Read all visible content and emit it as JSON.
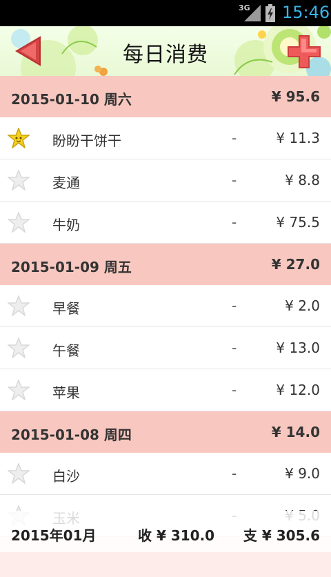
{
  "status_bar": {
    "network": "3G",
    "time": "15:46"
  },
  "header": {
    "title": "每日消费"
  },
  "days": [
    {
      "date": "2015-01-10  周六",
      "total": "¥ 95.6",
      "items": [
        {
          "name": "盼盼干饼干",
          "dash": "-",
          "amount": "¥ 11.3",
          "starred": true
        },
        {
          "name": "麦通",
          "dash": "-",
          "amount": "¥ 8.8",
          "starred": false
        },
        {
          "name": "牛奶",
          "dash": "-",
          "amount": "¥ 75.5",
          "starred": false
        }
      ]
    },
    {
      "date": "2015-01-09  周五",
      "total": "¥ 27.0",
      "items": [
        {
          "name": "早餐",
          "dash": "-",
          "amount": "¥ 2.0",
          "starred": false
        },
        {
          "name": "午餐",
          "dash": "-",
          "amount": "¥ 13.0",
          "starred": false
        },
        {
          "name": "苹果",
          "dash": "-",
          "amount": "¥ 12.0",
          "starred": false
        }
      ]
    },
    {
      "date": "2015-01-08  周四",
      "total": "¥ 14.0",
      "items": [
        {
          "name": "白沙",
          "dash": "-",
          "amount": "¥ 9.0",
          "starred": false
        },
        {
          "name": "玉米",
          "dash": "-",
          "amount": "¥ 5.0",
          "starred": false
        }
      ]
    }
  ],
  "footer": {
    "month": "2015年01月",
    "income": "收 ¥ 310.0",
    "expense": "支 ¥ 305.6"
  },
  "colors": {
    "day_header_bg": "#f8c8c0",
    "time_color": "#38b4e8",
    "star_active": "#f5d020"
  }
}
